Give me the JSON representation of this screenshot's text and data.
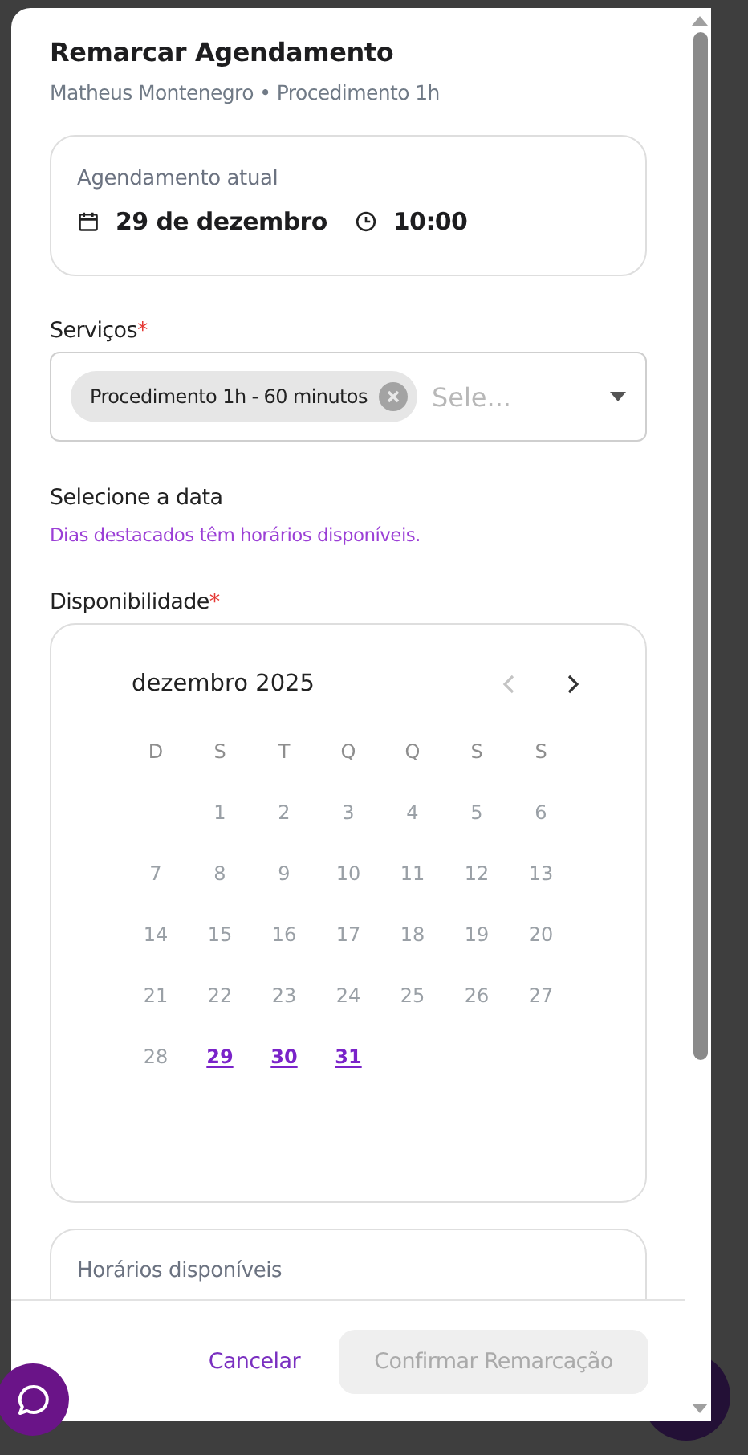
{
  "dialog": {
    "title": "Remarcar Agendamento",
    "subtitle": "Matheus Montenegro • Procedimento 1h"
  },
  "current": {
    "label": "Agendamento atual",
    "date": "29 de dezembro",
    "time": "10:00"
  },
  "services": {
    "label": "Serviços",
    "required_mark": "*",
    "chips": [
      {
        "label": "Procedimento 1h - 60 minutos"
      }
    ],
    "placeholder": "Sele..."
  },
  "date_section": {
    "title": "Selecione a data",
    "hint": "Dias destacados têm horários disponíveis."
  },
  "availability": {
    "label": "Disponibilidade",
    "required_mark": "*"
  },
  "calendar": {
    "month": "dezembro 2025",
    "prev_disabled": true,
    "next_disabled": false,
    "weekdays": [
      "D",
      "S",
      "T",
      "Q",
      "Q",
      "S",
      "S"
    ],
    "weeks": [
      [
        {
          "kind": "blank"
        },
        {
          "kind": "day",
          "day": "1",
          "available": false
        },
        {
          "kind": "day",
          "day": "2",
          "available": false
        },
        {
          "kind": "day",
          "day": "3",
          "available": false
        },
        {
          "kind": "day",
          "day": "4",
          "available": false
        },
        {
          "kind": "day",
          "day": "5",
          "available": false
        },
        {
          "kind": "day",
          "day": "6",
          "available": false
        }
      ],
      [
        {
          "kind": "day",
          "day": "7",
          "available": false
        },
        {
          "kind": "day",
          "day": "8",
          "available": false
        },
        {
          "kind": "day",
          "day": "9",
          "available": false
        },
        {
          "kind": "day",
          "day": "10",
          "available": false
        },
        {
          "kind": "day",
          "day": "11",
          "available": false
        },
        {
          "kind": "day",
          "day": "12",
          "available": false
        },
        {
          "kind": "day",
          "day": "13",
          "available": false
        }
      ],
      [
        {
          "kind": "day",
          "day": "14",
          "available": false
        },
        {
          "kind": "day",
          "day": "15",
          "available": false
        },
        {
          "kind": "day",
          "day": "16",
          "available": false
        },
        {
          "kind": "day",
          "day": "17",
          "available": false
        },
        {
          "kind": "day",
          "day": "18",
          "available": false
        },
        {
          "kind": "day",
          "day": "19",
          "available": false
        },
        {
          "kind": "day",
          "day": "20",
          "available": false
        }
      ],
      [
        {
          "kind": "day",
          "day": "21",
          "available": false
        },
        {
          "kind": "day",
          "day": "22",
          "available": false
        },
        {
          "kind": "day",
          "day": "23",
          "available": false
        },
        {
          "kind": "day",
          "day": "24",
          "available": false
        },
        {
          "kind": "day",
          "day": "25",
          "available": false
        },
        {
          "kind": "day",
          "day": "26",
          "available": false
        },
        {
          "kind": "day",
          "day": "27",
          "available": false
        }
      ],
      [
        {
          "kind": "day",
          "day": "28",
          "available": false
        },
        {
          "kind": "day",
          "day": "29",
          "available": true
        },
        {
          "kind": "day",
          "day": "30",
          "available": true
        },
        {
          "kind": "day",
          "day": "31",
          "available": true
        }
      ]
    ]
  },
  "times": {
    "title": "Horários disponíveis"
  },
  "footer": {
    "cancel": "Cancelar",
    "confirm": {
      "label": "Confirmar Remarcação",
      "disabled": true
    }
  }
}
